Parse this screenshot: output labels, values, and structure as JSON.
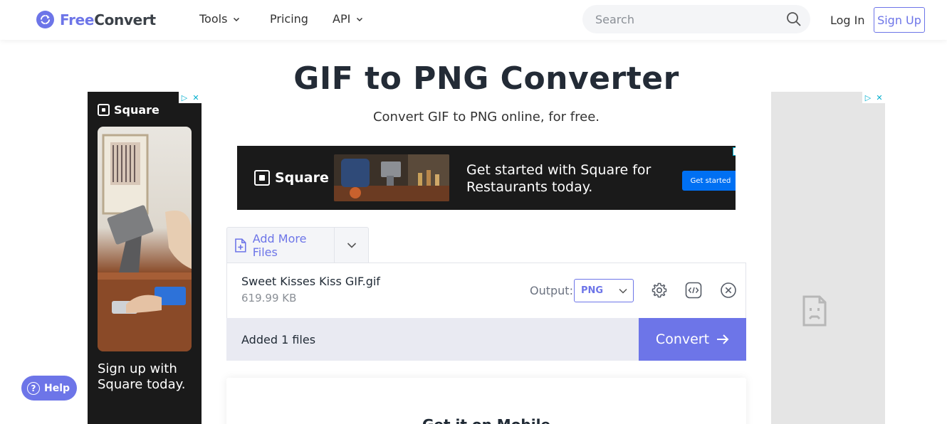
{
  "header": {
    "logo_free": "Free",
    "logo_convert": "Convert",
    "nav": [
      {
        "label": "Tools"
      },
      {
        "label": "Pricing"
      },
      {
        "label": "API"
      }
    ],
    "search_placeholder": "Search",
    "login_label": "Log In",
    "signup_label": "Sign Up"
  },
  "main": {
    "title": "GIF to PNG Converter",
    "subtitle": "Convert GIF to PNG online, for free."
  },
  "ads": {
    "left": {
      "brand": "Square",
      "tagline": "Sign up with Square today."
    },
    "banner": {
      "brand": "Square",
      "headline": "Get started with Square for Restaurants today.",
      "cta": "Get started"
    }
  },
  "converter": {
    "add_more_label": "Add More Files",
    "file": {
      "name": "Sweet Kisses Kiss GIF.gif",
      "size": "619.99 KB",
      "output_label": "Output:",
      "output_value": "PNG"
    },
    "added_text": "Added 1 files",
    "convert_label": "Convert"
  },
  "mobile": {
    "title": "Get it on Mobile"
  },
  "help": {
    "label": "Help"
  },
  "colors": {
    "accent": "#6d75e8",
    "bar_bg": "#e9eaf2",
    "ad_dark": "#1a1a1a"
  }
}
